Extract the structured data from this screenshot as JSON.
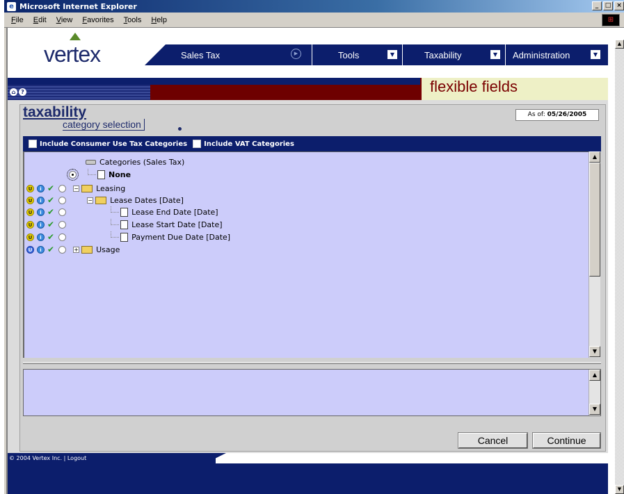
{
  "window": {
    "title": "Microsoft Internet Explorer",
    "min": "_",
    "max": "□",
    "close": "×",
    "ie_logo": "e",
    "winlogo": "⊞"
  },
  "menu": [
    "File",
    "Edit",
    "View",
    "Favorites",
    "Tools",
    "Help"
  ],
  "brand": {
    "logo": "vertex",
    "accent": "#5a8a2a",
    "navy": "#0c1e6c",
    "maroon": "#6e0000"
  },
  "nav": {
    "sales_tax": "Sales Tax",
    "tools": "Tools",
    "taxability": "Taxability",
    "administration": "Administration",
    "dropdown_glyph": "▼",
    "play_glyph": "▶"
  },
  "header": {
    "banner": "flexible fields",
    "home_glyph": "⌂",
    "help_glyph": "?"
  },
  "page": {
    "title": "taxability",
    "subtitle": "category selection",
    "as_of_label": "As of:",
    "as_of_date": "05/26/2005"
  },
  "options": {
    "consumer_use": "Include Consumer Use Tax Categories",
    "vat": "Include VAT Categories"
  },
  "tree": {
    "root": "Categories (Sales Tax)",
    "rows": [
      {
        "label": "None",
        "bold": true
      },
      {
        "label": "Leasing"
      },
      {
        "label": "Lease Dates [Date]"
      },
      {
        "label": "Lease End Date [Date]"
      },
      {
        "label": "Lease Start Date [Date]"
      },
      {
        "label": "Payment Due Date [Date]"
      },
      {
        "label": "Usage"
      }
    ],
    "expand_minus": "−",
    "expand_plus": "+",
    "status_u": "U",
    "status_i": "i",
    "check": "✔"
  },
  "scroll": {
    "up": "▲",
    "down": "▼"
  },
  "buttons": {
    "cancel": "Cancel",
    "continue": "Continue"
  },
  "footer": {
    "copyright": "© 2004 Vertex Inc.",
    "separator": " | ",
    "logout": "Logout"
  }
}
